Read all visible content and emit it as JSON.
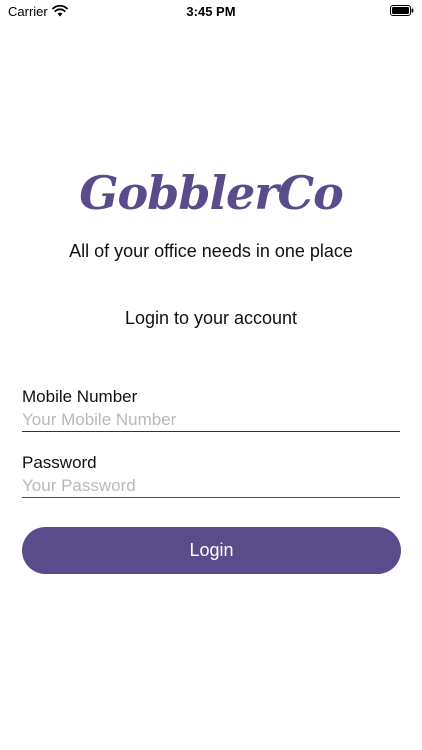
{
  "status_bar": {
    "carrier": "Carrier",
    "time": "3:45 PM",
    "icons": [
      "wifi-icon",
      "battery-icon"
    ]
  },
  "brand": {
    "logo_text": "GobblerCo",
    "tagline": "All of your office needs in one place"
  },
  "form": {
    "heading": "Login to your account",
    "mobile": {
      "label": "Mobile Number",
      "placeholder": "Your Mobile Number",
      "value": ""
    },
    "password": {
      "label": "Password",
      "placeholder": "Your Password",
      "value": ""
    },
    "submit_label": "Login"
  },
  "colors": {
    "brand_purple": "#5a4b8a",
    "placeholder_gray": "#b8b8bd",
    "text": "#111111",
    "background": "#ffffff"
  }
}
